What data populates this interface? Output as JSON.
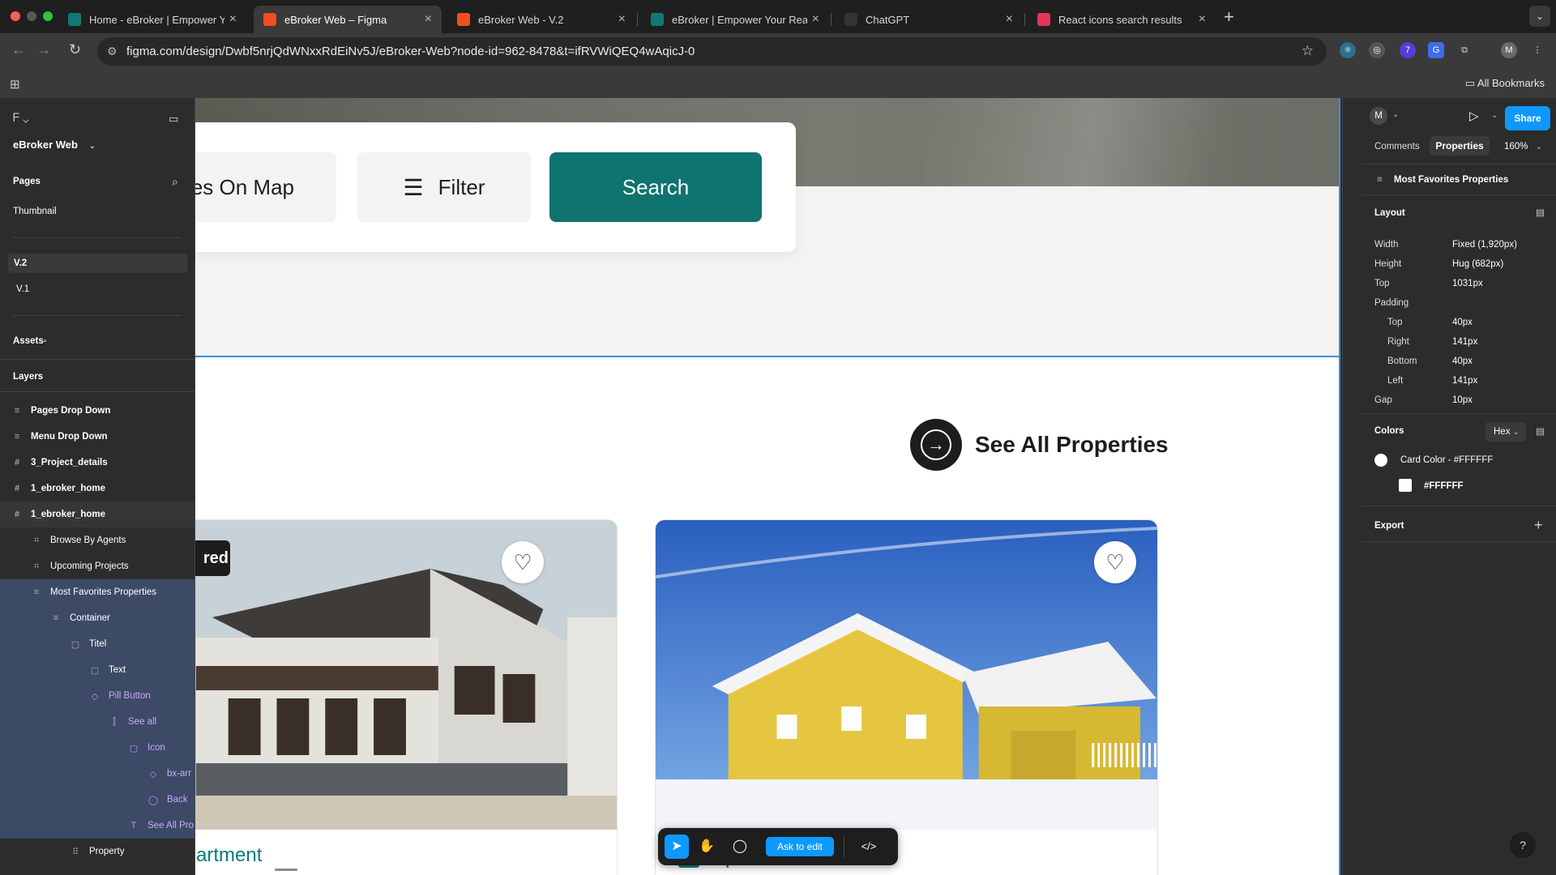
{
  "browser": {
    "tabs": [
      {
        "title": "Home - eBroker | Empower Yo",
        "fav_color": "#0f7b74",
        "active": false
      },
      {
        "title": "eBroker Web – Figma",
        "fav_color": "#f24e1e",
        "active": true
      },
      {
        "title": "eBroker Web - V.2",
        "fav_color": "#f24e1e",
        "active": false
      },
      {
        "title": "eBroker | Empower Your Real",
        "fav_color": "#0f7b74",
        "active": false
      },
      {
        "title": "ChatGPT",
        "fav_color": "#333333",
        "active": false
      },
      {
        "title": "React icons search results",
        "fav_color": "#e2365b",
        "active": false
      }
    ],
    "url": "figma.com/design/Dwbf5nrjQdWNxxRdEiNv5J/eBroker-Web?node-id=962-8478&t=ifRVWiQEQ4wAqicJ-0",
    "all_bookmarks": "All Bookmarks",
    "ext_badge": "7",
    "profile_initial": "M"
  },
  "left_panel": {
    "file_name": "eBroker Web",
    "pages_header": "Pages",
    "pages": [
      "Thumbnail",
      "V.2",
      "V.1"
    ],
    "assets": "Assets",
    "layers_header": "Layers",
    "layers": [
      {
        "label": "Pages Drop Down",
        "icon": "≡",
        "indent": 0
      },
      {
        "label": "Menu Drop Down",
        "icon": "≡",
        "indent": 0
      },
      {
        "label": "3_Project_details",
        "icon": "#",
        "indent": 0
      },
      {
        "label": "1_ebroker_home",
        "icon": "#",
        "indent": 0
      },
      {
        "label": "1_ebroker_home",
        "icon": "#",
        "indent": 0
      },
      {
        "label": "Browse  By Agents",
        "icon": "⌗",
        "indent": 1
      },
      {
        "label": "Upcoming Projects",
        "icon": "⌗",
        "indent": 1
      },
      {
        "label": "Most Favorites Properties",
        "icon": "≡",
        "indent": 1
      },
      {
        "label": "Container",
        "icon": "≡",
        "indent": 2
      },
      {
        "label": "Titel",
        "icon": "▢",
        "indent": 3
      },
      {
        "label": "Text",
        "icon": "▢",
        "indent": 4
      },
      {
        "label": "Pill Button",
        "icon": "◇",
        "indent": 4
      },
      {
        "label": "See all",
        "icon": "⫿",
        "indent": 5
      },
      {
        "label": "Icon",
        "icon": "▢",
        "indent": 6
      },
      {
        "label": "bx-arr",
        "icon": "◇",
        "indent": 7
      },
      {
        "label": "Back",
        "icon": "◯",
        "indent": 7
      },
      {
        "label": "See All Pro",
        "icon": "T",
        "indent": 6
      },
      {
        "label": "Property",
        "icon": "⠿",
        "indent": 3
      }
    ]
  },
  "canvas": {
    "search_card": {
      "map_label": "es On Map",
      "filter_label": "Filter",
      "search_label": "Search"
    },
    "see_all_label": "See All Properties",
    "featured_label": "red",
    "card1_title": "artment",
    "card2_title": "Apartment",
    "colors": {
      "teal": "#0f7370",
      "dark": "#1d1d1d",
      "selection": "#3b8ee0"
    }
  },
  "bottom_toolbar": {
    "ask_label": "Ask to edit"
  },
  "right_panel": {
    "profile_initial": "M",
    "share": "Share",
    "tabs": [
      "Comments",
      "Properties"
    ],
    "zoom": "160%",
    "selection_name": "Most Favorites Properties",
    "layout_header": "Layout",
    "rows": [
      {
        "label": "Width",
        "value": "Fixed (1,920px)"
      },
      {
        "label": "Height",
        "value": "Hug (682px)"
      },
      {
        "label": "Top",
        "value": "1031px"
      },
      {
        "label": "Padding",
        "value": ""
      },
      {
        "label": "Top",
        "value": "40px"
      },
      {
        "label": "Right",
        "value": "141px"
      },
      {
        "label": "Bottom",
        "value": "40px"
      },
      {
        "label": "Left",
        "value": "141px"
      },
      {
        "label": "Gap",
        "value": "10px"
      }
    ],
    "colors_header": "Colors",
    "color_mode": "Hex",
    "color_style": "Card Color - #FFFFFF",
    "color_hex": "#FFFFFF",
    "export_header": "Export"
  }
}
